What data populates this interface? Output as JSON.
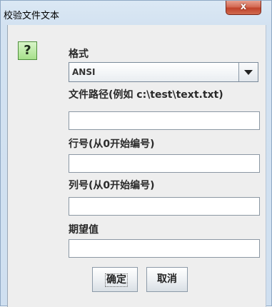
{
  "window": {
    "title": "校验文件文本",
    "close_glyph": "x"
  },
  "icon": {
    "name": "question-icon",
    "glyph": "?"
  },
  "form": {
    "format_label": "格式",
    "format_value": "ANSI",
    "path_label": "文件路径(例如 c:\\test\\text.txt)",
    "path_value": "",
    "line_label": "行号(从0开始编号)",
    "line_value": "",
    "column_label": "列号(从0开始编号)",
    "column_value": "",
    "expected_label": "期望值",
    "expected_value": ""
  },
  "buttons": {
    "ok": "确定",
    "cancel": "取消"
  }
}
